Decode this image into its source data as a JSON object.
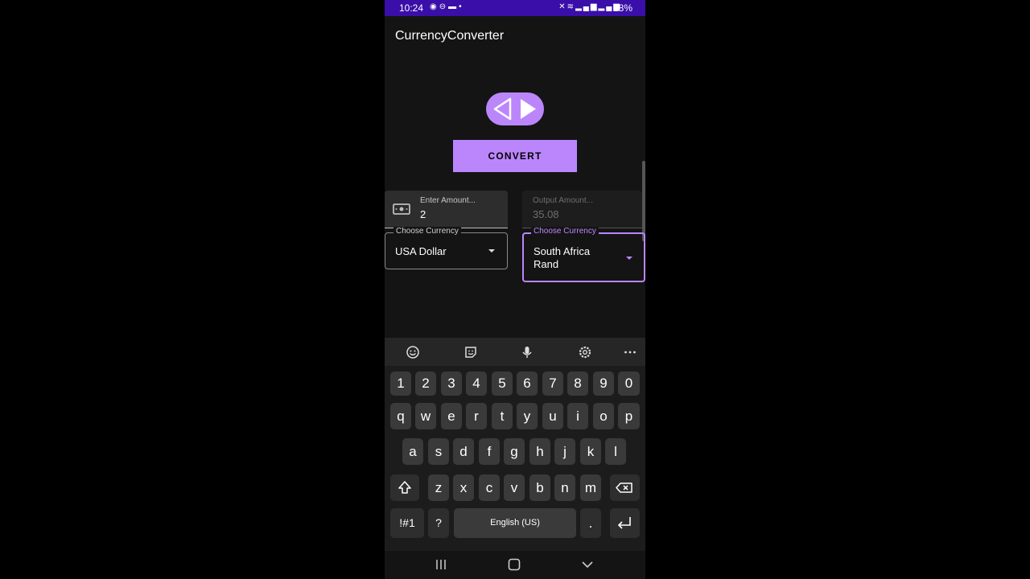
{
  "status_bar": {
    "time": "10:24",
    "battery": "28%",
    "left_icons": [
      "notification-icon",
      "dnd-icon",
      "folder-icon",
      "dot-icon"
    ],
    "right_icons": [
      "mute-icon",
      "wifi-icon",
      "signal-icon",
      "signal-icon"
    ]
  },
  "app": {
    "title": "CurrencyConverter",
    "accent_color": "#bb86fc"
  },
  "swap_button": {
    "icon": "swap-arrows-icon"
  },
  "convert_button": {
    "label": "CONVERT"
  },
  "amount_field": {
    "label": "Enter Amount...",
    "value": "2",
    "icon": "money-icon"
  },
  "output_field": {
    "label": "Output Amount...",
    "value": "35.08"
  },
  "from_currency": {
    "label": "Choose Currency",
    "value": "USA Dollar"
  },
  "to_currency": {
    "label": "Choose Currency",
    "value": "South Africa Rand"
  },
  "keyboard": {
    "toolbar": [
      "emoji-icon",
      "sticker-icon",
      "microphone-icon",
      "settings-icon",
      "more-icon"
    ],
    "row_numbers": [
      "1",
      "2",
      "3",
      "4",
      "5",
      "6",
      "7",
      "8",
      "9",
      "0"
    ],
    "row_1": [
      "q",
      "w",
      "e",
      "r",
      "t",
      "y",
      "u",
      "i",
      "o",
      "p"
    ],
    "row_2": [
      "a",
      "s",
      "d",
      "f",
      "g",
      "h",
      "j",
      "k",
      "l"
    ],
    "row_3": [
      "z",
      "x",
      "c",
      "v",
      "b",
      "n",
      "m"
    ],
    "symbols_key": "!#1",
    "question_key": "?",
    "space_label": "English (US)",
    "period_key": "."
  },
  "nav_bar": [
    "recents-icon",
    "home-icon",
    "back-icon"
  ]
}
